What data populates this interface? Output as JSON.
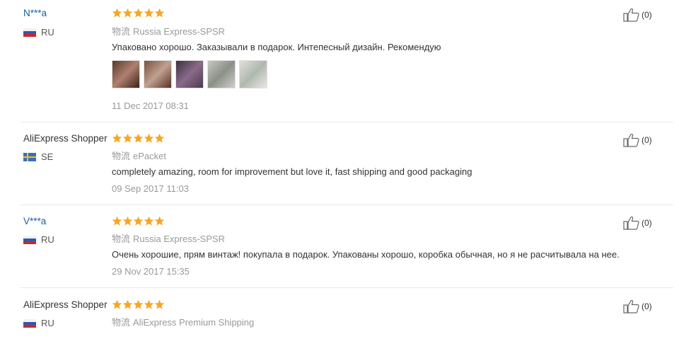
{
  "colors": {
    "star": "#f5a623",
    "link": "#1a5ea8"
  },
  "reviews": [
    {
      "user": "N***a",
      "country": "RU",
      "flag": "ru-flag-icon",
      "shipping_label": "物流",
      "shipping": "Russia Express-SPSR",
      "text": "Упаковано хорошо. Заказывали в подарок. Интепесный дизайн. Рекомендую",
      "date": "11 Dec 2017 08:31",
      "helpful": "(0)",
      "rating": 5,
      "photo_count": 5
    },
    {
      "user": "AliExpress Shopper",
      "country": "SE",
      "flag": "se-flag-icon",
      "shipping_label": "物流",
      "shipping": "ePacket",
      "text": "completely amazing, room for improvement but love it, fast shipping and good packaging",
      "date": "09 Sep 2017 11:03",
      "helpful": "(0)",
      "rating": 5
    },
    {
      "user": "V***a",
      "country": "RU",
      "flag": "ru-flag-icon",
      "shipping_label": "物流",
      "shipping": "Russia Express-SPSR",
      "text": "Очень хорошие, прям винтаж! покупала в подарок. Упакованы хорошо, коробка обычная, но я не расчитывала на нее.",
      "date": "29 Nov 2017 15:35",
      "helpful": "(0)",
      "rating": 5
    },
    {
      "user": "AliExpress Shopper",
      "country": "RU",
      "flag": "ru-flag-icon",
      "shipping_label": "物流",
      "shipping": "AliExpress Premium Shipping",
      "helpful": "(0)",
      "rating": 5
    }
  ]
}
